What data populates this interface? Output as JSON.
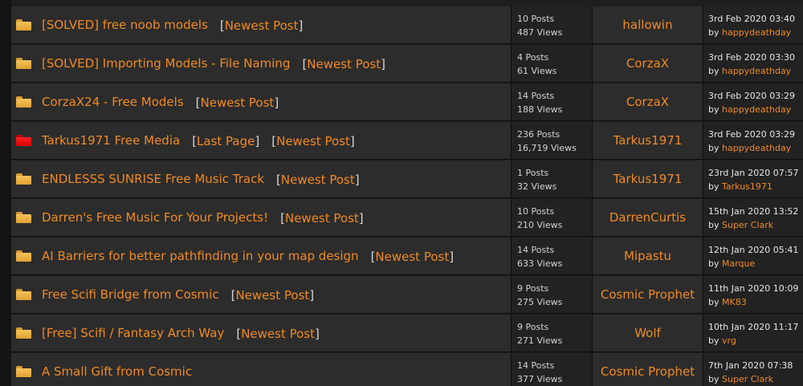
{
  "threads": [
    {
      "title": "[SOLVED] free noob models",
      "icon": "folder-icon",
      "tags": [
        "Newest Post"
      ],
      "posts": "10 Posts",
      "views": "487 Views",
      "last_poster": "hallowin",
      "date": "3rd Feb 2020 03:40",
      "by_label": "by",
      "date_by": "happydeathday"
    },
    {
      "title": "[SOLVED] Importing Models - File Naming",
      "icon": "folder-icon",
      "tags": [
        "Newest Post"
      ],
      "posts": "4 Posts",
      "views": "61 Views",
      "last_poster": "CorzaX",
      "date": "3rd Feb 2020 03:30",
      "by_label": "by",
      "date_by": "happydeathday"
    },
    {
      "title": "CorzaX24 - Free Models",
      "icon": "folder-icon",
      "tags": [
        "Newest Post"
      ],
      "posts": "14 Posts",
      "views": "188 Views",
      "last_poster": "CorzaX",
      "date": "3rd Feb 2020 03:29",
      "by_label": "by",
      "date_by": "happydeathday"
    },
    {
      "title": "Tarkus1971 Free Media",
      "icon": "hot-folder-icon",
      "tags": [
        "Last Page",
        "Newest Post"
      ],
      "posts": "236 Posts",
      "views": "16,719 Views",
      "last_poster": "Tarkus1971",
      "date": "3rd Feb 2020 03:29",
      "by_label": "by",
      "date_by": "happydeathday"
    },
    {
      "title": "ENDLESSS SUNRISE Free Music Track",
      "icon": "folder-icon",
      "tags": [
        "Newest Post"
      ],
      "posts": "1 Posts",
      "views": "32 Views",
      "last_poster": "Tarkus1971",
      "date": "23rd Jan 2020 07:57",
      "by_label": "by",
      "date_by": "Tarkus1971"
    },
    {
      "title": "Darren's Free Music For Your Projects!",
      "icon": "folder-icon",
      "tags": [
        "Newest Post"
      ],
      "posts": "10 Posts",
      "views": "210 Views",
      "last_poster": "DarrenCurtis",
      "date": "15th Jan 2020 13:52",
      "by_label": "by",
      "date_by": "Super Clark"
    },
    {
      "title": "AI Barriers for better pathfinding in your map design",
      "icon": "folder-icon",
      "tags": [
        "Newest Post"
      ],
      "posts": "14 Posts",
      "views": "633 Views",
      "last_poster": "Mipastu",
      "date": "12th Jan 2020 05:41",
      "by_label": "by",
      "date_by": "Marque"
    },
    {
      "title": "Free Scifi Bridge from Cosmic",
      "icon": "folder-icon",
      "tags": [
        "Newest Post"
      ],
      "posts": "9 Posts",
      "views": "275 Views",
      "last_poster": "Cosmic Prophet",
      "date": "11th Jan 2020 10:09",
      "by_label": "by",
      "date_by": "MK83"
    },
    {
      "title": "[Free] Scifi / Fantasy Arch Way",
      "icon": "folder-icon",
      "tags": [
        "Newest Post"
      ],
      "posts": "9 Posts",
      "views": "271 Views",
      "last_poster": "Wolf",
      "date": "10th Jan 2020 11:17",
      "by_label": "by",
      "date_by": "vrg"
    },
    {
      "title": "A Small Gift from Cosmic",
      "icon": "folder-icon",
      "tags": [],
      "posts": "14 Posts",
      "views": "377 Views",
      "last_poster": "Cosmic Prophet",
      "date": "7th Jan 2020 07:38",
      "by_label": "by",
      "date_by": "Super Clark"
    }
  ],
  "colors": {
    "link": "#f08a24",
    "row_bg": "#2c2c2c",
    "stats_bg": "#222222",
    "hot_icon": "#e00000",
    "folder_icon": "#f0b040"
  }
}
